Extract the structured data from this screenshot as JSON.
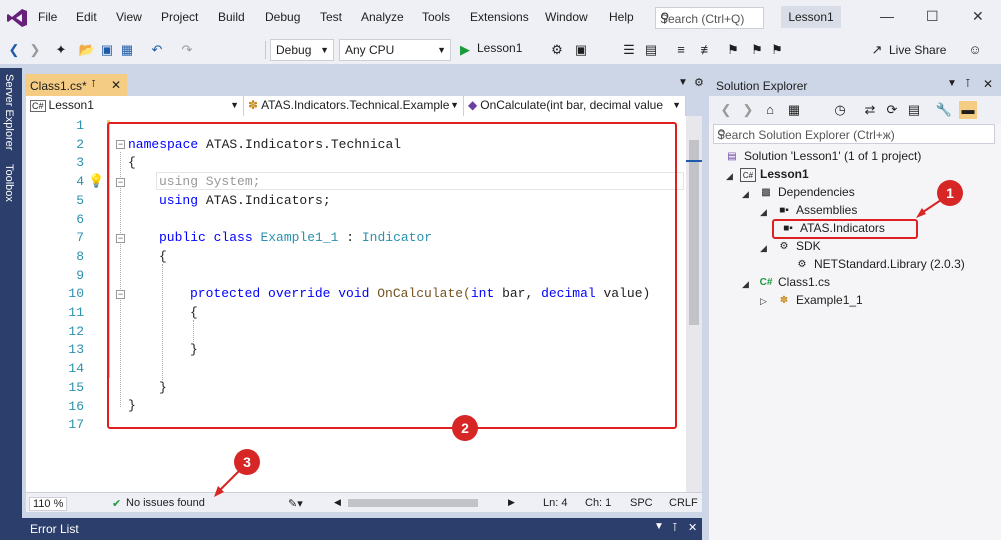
{
  "menu": [
    "File",
    "Edit",
    "View",
    "Project",
    "Build",
    "Debug",
    "Test",
    "Analyze",
    "Tools",
    "Extensions",
    "Window",
    "Help"
  ],
  "search_placeholder": "Search (Ctrl+Q)",
  "solution_name": "Lesson1",
  "toolbar": {
    "config": "Debug",
    "platform": "Any CPU",
    "start_label": "Lesson1",
    "live_share": "Live Share"
  },
  "left_tabs": [
    "Server Explorer",
    "Toolbox"
  ],
  "editor": {
    "tab_label": "Class1.cs*",
    "nav_project": "Lesson1",
    "nav_type": "ATAS.Indicators.Technical.Example",
    "nav_member": "OnCalculate(int bar, decimal value",
    "line_numbers": [
      "1",
      "2",
      "3",
      "4",
      "5",
      "6",
      "7",
      "8",
      "9",
      "10",
      "11",
      "12",
      "13",
      "14",
      "15",
      "16",
      "17"
    ],
    "code": {
      "l2_kw": "namespace",
      "l2_rest": " ATAS.Indicators.Technical",
      "l3": "{",
      "l4": "using System;",
      "l5_kw": "using",
      "l5_rest": " ATAS.Indicators;",
      "l7_kw": "public class",
      "l7_type": "Example1_1",
      "l7_mid": " : ",
      "l7_base": "Indicator",
      "l8": "{",
      "l10_kw": "protected override void",
      "l10_name": " OnCalculate(",
      "l10_int": "int",
      "l10_bar": " bar, ",
      "l10_dec": "decimal",
      "l10_end": " value)",
      "l11": "{",
      "l13": "}",
      "l15": "}",
      "l16": "}"
    },
    "zoom": "110 %",
    "issues": "No issues found",
    "ln": "Ln: 4",
    "ch": "Ch: 1",
    "spc": "SPC",
    "crlf": "CRLF"
  },
  "error_list_title": "Error List",
  "solution_explorer": {
    "title": "Solution Explorer",
    "search_placeholder": "Search Solution Explorer (Ctrl+ж)",
    "items": [
      {
        "label": "Solution 'Lesson1' (1 of 1 project)"
      },
      {
        "label": "Lesson1"
      },
      {
        "label": "Dependencies"
      },
      {
        "label": "Assemblies"
      },
      {
        "label": "ATAS.Indicators"
      },
      {
        "label": "SDK"
      },
      {
        "label": "NETStandard.Library (2.0.3)"
      },
      {
        "label": "Class1.cs"
      },
      {
        "label": "Example1_1"
      }
    ]
  },
  "badges": [
    "1",
    "2",
    "3"
  ],
  "colors": {
    "highlight": "#e02020",
    "keyword": "#0000ff",
    "type": "#2b91af",
    "panel_dark": "#2c3e6b"
  }
}
